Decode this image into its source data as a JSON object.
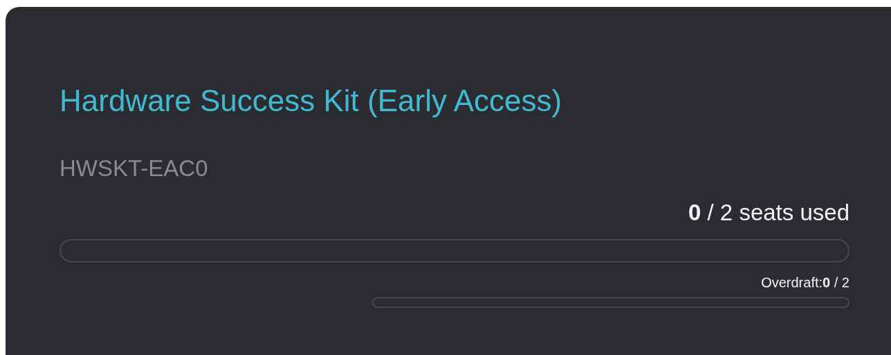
{
  "product": {
    "title": "Hardware Success Kit (Early Access)",
    "code": "HWSKT-EAC0"
  },
  "seats": {
    "label": "**0** / 2 seats used",
    "level": 0
  },
  "overdraft": {
    "label": "Overdraft:**0** / 2",
    "level": 0
  }
}
